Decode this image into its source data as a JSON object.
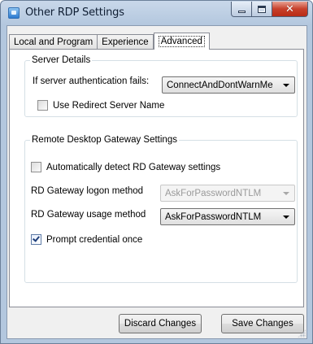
{
  "window": {
    "title": "Other RDP Settings"
  },
  "caption": {
    "minimize_icon": "minimize-icon",
    "maximize_icon": "maximize-icon",
    "close_glyph": "✕"
  },
  "tabs": [
    {
      "label": "Local and Program",
      "active": false
    },
    {
      "label": "Experience",
      "active": false
    },
    {
      "label": "Advanced",
      "active": true
    }
  ],
  "server_details": {
    "title": "Server Details",
    "auth_fail_label": "If server authentication fails:",
    "auth_fail_value": "ConnectAndDontWarnMe",
    "use_redirect_label": "Use Redirect Server Name",
    "use_redirect_checked": false
  },
  "gateway": {
    "title": "Remote Desktop Gateway Settings",
    "auto_detect_label": "Automatically detect RD Gateway settings",
    "auto_detect_checked": false,
    "logon_method_label": "RD Gateway logon method",
    "logon_method_value": "AskForPasswordNTLM",
    "logon_method_enabled": false,
    "usage_method_label": "RD Gateway usage method",
    "usage_method_value": "AskForPasswordNTLM",
    "prompt_once_label": "Prompt credential once",
    "prompt_once_checked": true
  },
  "actions": {
    "discard_label": "Discard Changes",
    "save_label": "Save Changes"
  }
}
